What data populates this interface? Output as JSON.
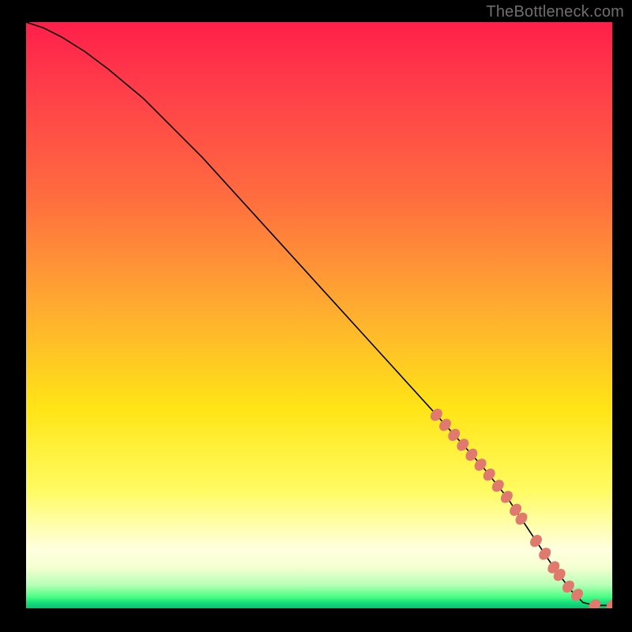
{
  "attribution": "TheBottleneck.com",
  "chart_data": {
    "type": "line",
    "title": "",
    "xlabel": "",
    "ylabel": "",
    "xlim": [
      0,
      100
    ],
    "ylim": [
      0,
      100
    ],
    "grid": false,
    "legend": false,
    "background": "rainbow-vertical",
    "series": [
      {
        "name": "curve",
        "x": [
          0,
          3,
          6,
          10,
          14,
          20,
          30,
          40,
          50,
          60,
          70,
          78,
          82,
          86,
          90,
          93,
          95,
          97,
          100
        ],
        "y": [
          100,
          99,
          97.5,
          95,
          92,
          87,
          77,
          66,
          55,
          44,
          33,
          24,
          19,
          13,
          7,
          3,
          1,
          0.5,
          0.5
        ]
      }
    ],
    "markers": {
      "name": "highlight-points",
      "color": "#e07a6f",
      "x": [
        70,
        71.5,
        73,
        74.5,
        76,
        77.5,
        79,
        80.5,
        82,
        83.5,
        84.5,
        87,
        88.5,
        90,
        91,
        92.5,
        94,
        97,
        100
      ],
      "y": [
        33,
        31.3,
        29.6,
        27.9,
        26.2,
        24.5,
        22.8,
        20.9,
        19,
        16.8,
        15.3,
        11.5,
        9.3,
        7,
        5.7,
        3.7,
        2.3,
        0.5,
        0.5
      ]
    }
  }
}
